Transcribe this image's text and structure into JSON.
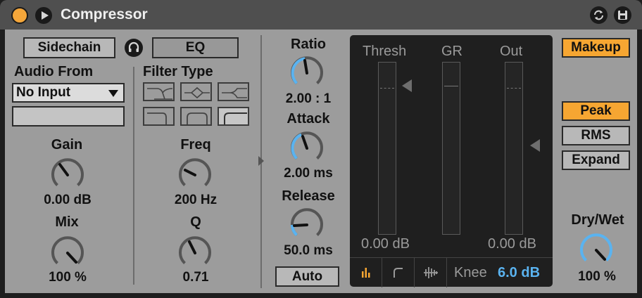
{
  "device": {
    "title": "Compressor",
    "power_on": true,
    "accent_color": "#f6a632",
    "knob_arc_color": "#5ab3f0"
  },
  "sidechain": {
    "sidechain_label": "Sidechain",
    "headphone_icon": "headphones-icon",
    "eq_label": "EQ",
    "audio_from_label": "Audio From",
    "audio_from_value": "No Input",
    "channel_value": "",
    "gain": {
      "label": "Gain",
      "value": "0.00 dB"
    },
    "mix": {
      "label": "Mix",
      "value": "100 %"
    }
  },
  "filter": {
    "filter_type_label": "Filter Type",
    "types": [
      "lowpass",
      "bandpass",
      "highpass",
      "low-shelf",
      "notch",
      "high-shelf-selected"
    ],
    "freq": {
      "label": "Freq",
      "value": "200 Hz"
    },
    "q": {
      "label": "Q",
      "value": "0.71"
    }
  },
  "dynamics": {
    "ratio": {
      "label": "Ratio",
      "value": "2.00 : 1"
    },
    "attack": {
      "label": "Attack",
      "value": "2.00 ms"
    },
    "release": {
      "label": "Release",
      "value": "50.0 ms"
    },
    "auto_label": "Auto"
  },
  "display": {
    "thresh_label": "Thresh",
    "gr_label": "GR",
    "out_label": "Out",
    "thresh_value": "0.00 dB",
    "out_value": "0.00 dB",
    "knee_label": "Knee",
    "knee_value": "6.0 dB",
    "tabs": [
      "activity-view-icon",
      "transfer-curve-icon",
      "waveform-view-icon"
    ]
  },
  "right": {
    "makeup_label": "Makeup",
    "peak_label": "Peak",
    "rms_label": "RMS",
    "expand_label": "Expand",
    "drywet": {
      "label": "Dry/Wet",
      "value": "100 %"
    }
  }
}
